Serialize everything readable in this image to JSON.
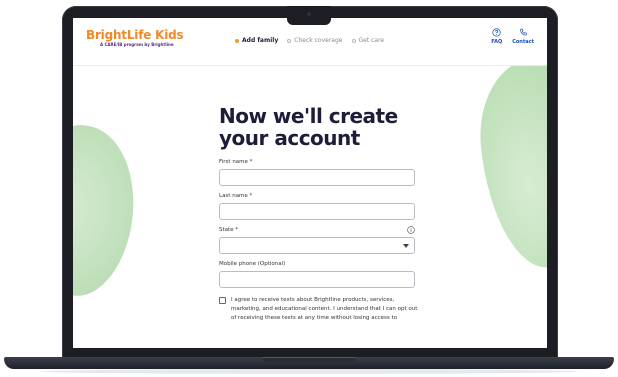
{
  "header": {
    "logo_main": "BrightLife Kids",
    "logo_sub": "A CARE/IB program by Brightline",
    "steps": [
      {
        "label": "Add family",
        "active": true
      },
      {
        "label": "Check coverage",
        "active": false
      },
      {
        "label": "Get care",
        "active": false
      }
    ],
    "faq_label": "FAQ",
    "contact_label": "Contact"
  },
  "form": {
    "headline": "Now we'll create your account",
    "first_name_label": "First name *",
    "last_name_label": "Last name *",
    "state_label": "State *",
    "mobile_label": "Mobile phone (Optional)",
    "consent_text": "I agree to receive texts about Brightline products, services, marketing, and educational content. I understand that I can opt out of receiving these texts at any time without losing access to"
  },
  "colors": {
    "accent_orange": "#f08a24",
    "link_blue": "#1a4fbf",
    "headline_navy": "#1d1d3a",
    "blob_green": "#c4e2bf"
  }
}
